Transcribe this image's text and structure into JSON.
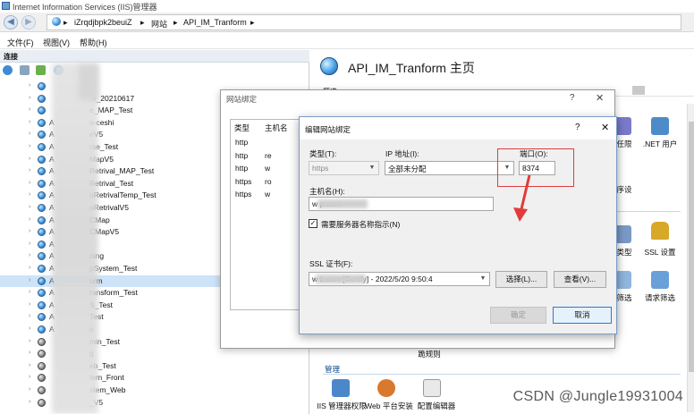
{
  "window": {
    "title": "Internet Information Services (IIS)管理器"
  },
  "address": {
    "segments": [
      "iZrqdjbpk2beuiZ",
      "网站",
      "API_IM_Tranform"
    ],
    "separator": "▸"
  },
  "menu": [
    "文件(F)",
    "视图(V)",
    "帮助(H)"
  ],
  "left": {
    "header": "连接",
    "tree": [
      {
        "pre": "",
        "label": "re"
      },
      {
        "pre": "",
        "label": "re_20210617"
      },
      {
        "pre": "",
        "label": "e_MAP_Test"
      },
      {
        "pre": "A",
        "label": "o-ceshi"
      },
      {
        "pre": "A",
        "label": "eV5"
      },
      {
        "pre": "A",
        "label": "rse_Test"
      },
      {
        "pre": "A",
        "label": "MapV5"
      },
      {
        "pre": "A",
        "label": "Retrival_MAP_Test"
      },
      {
        "pre": "A",
        "label": "Retrival_Test"
      },
      {
        "pre": "A",
        "label": "oRetrivalTemp_Test"
      },
      {
        "pre": "A",
        "label": "oRetrivalV5"
      },
      {
        "pre": "A",
        "label": "CMap"
      },
      {
        "pre": "A",
        "label": "CMapV5"
      },
      {
        "pre": "A",
        "label": ""
      },
      {
        "pre": "A",
        "label": "ning"
      },
      {
        "pre": "A",
        "label": "pSystem_Test"
      },
      {
        "pre": "A",
        "label": "orm"
      },
      {
        "pre": "A",
        "label": "ransform_Test"
      },
      {
        "pre": "A",
        "label": "S_Test"
      },
      {
        "pre": "A",
        "label": "Test"
      },
      {
        "pre": "A",
        "label": "n"
      },
      {
        "pre": "",
        "label": "min_Test"
      },
      {
        "pre": "",
        "label": "g"
      },
      {
        "pre": "",
        "label": "eb_Test"
      },
      {
        "pre": "",
        "label": "tem_Front"
      },
      {
        "pre": "",
        "label": "stem_Web"
      },
      {
        "pre": "",
        "label": "_V5"
      }
    ]
  },
  "right": {
    "title": "API_IM_Tranform 主页",
    "filter": "筛选:",
    "items": [
      {
        "label": "任限"
      },
      {
        "label": ".NET 用户"
      },
      {
        "label": "序设"
      },
      {
        "label": "类型"
      },
      {
        "label": "SSL 设置"
      },
      {
        "label": "筛选"
      },
      {
        "label": "请求筛选"
      },
      {
        "label": "跪规则"
      }
    ],
    "section_manage": "管理",
    "manage_items": [
      "IIS 管理器权限",
      "Web 平台安装",
      "配置编辑器"
    ]
  },
  "dialog_bindings": {
    "title": "网站绑定",
    "col_type": "类型",
    "col_host": "主机名",
    "rows": [
      {
        "type": "http",
        "host": ""
      },
      {
        "type": "http",
        "host": "re"
      },
      {
        "type": "http",
        "host": "w"
      },
      {
        "type": "https",
        "host": "ro"
      },
      {
        "type": "https",
        "host": "w"
      }
    ]
  },
  "dialog_edit": {
    "title": "编辑网站绑定",
    "type_label": "类型(T):",
    "type_value": "https",
    "ip_label": "IP 地址(I):",
    "ip_value": "全部未分配",
    "port_label": "端口(O):",
    "port_value": "8374",
    "host_label": "主机名(H):",
    "host_value": "w          p.com",
    "sni_label": "需要服务器名称指示(N)",
    "sni_checked": true,
    "ssl_label": "SSL 证书(F):",
    "ssl_value": "w          b.com [Certify] - 2022/5/20 9:50:4",
    "btn_select": "选择(L)...",
    "btn_view": "查看(V)...",
    "btn_ok": "确定",
    "btn_cancel": "取消"
  },
  "watermark": "CSDN @Jungle19931004"
}
